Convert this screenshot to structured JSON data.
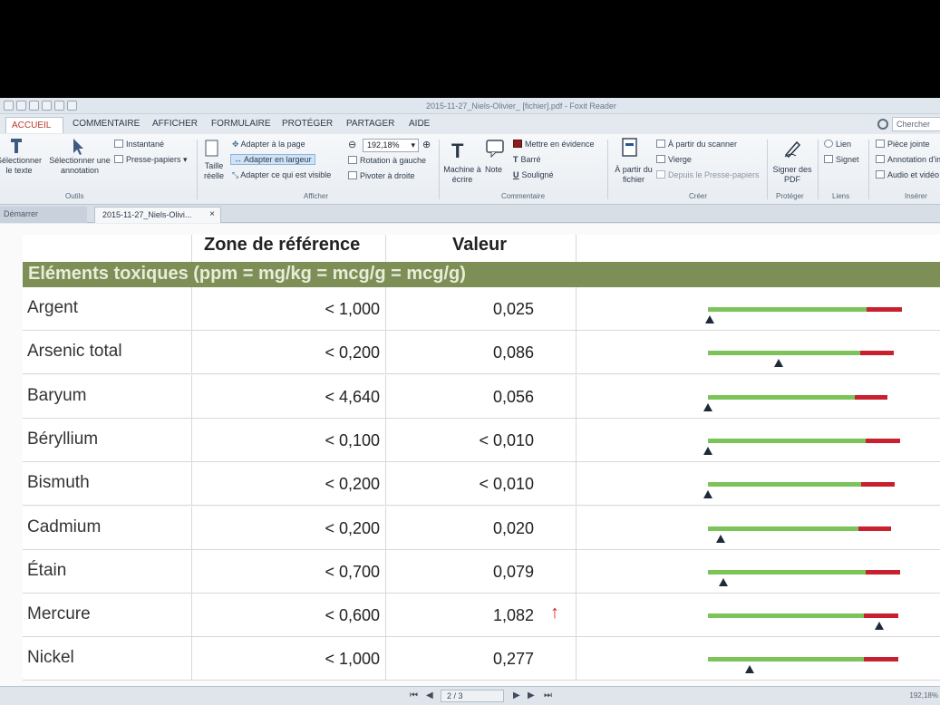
{
  "window": {
    "title": "2015-11-27_Niels-Olivier_  [fichier].pdf - Foxit Reader"
  },
  "menu": {
    "tabs": [
      "ACCUEIL",
      "COMMENTAIRE",
      "AFFICHER",
      "FORMULAIRE",
      "PROTÉGER",
      "PARTAGER",
      "AIDE"
    ],
    "search_label": "Chercher"
  },
  "ribbon": {
    "select_text": "Sélectionner le texte",
    "select_annotation": "Sélectionner une annotation",
    "snapshot": "Instantané",
    "clipboard": "Presse-papiers",
    "outils_group": "Outils",
    "taille_reelle": "Taille réelle",
    "fit_page": "Adapter à la page",
    "fit_width": "Adapter en largeur",
    "fit_visible": "Adapter ce qui est visible",
    "zoom": "192,18%",
    "rotate_left": "Rotation à gauche",
    "rotate_right": "Pivoter à droite",
    "afficher_group": "Afficher",
    "typewriter": "Machine à écrire",
    "note": "Note",
    "highlight": "Mettre en évidence",
    "strikeout": "Barré",
    "underline": "Souligné",
    "commentaire_group": "Commentaire",
    "from_file": "À partir du fichier",
    "from_scanner": "À partir du scanner",
    "blank": "Vierge",
    "from_clipboard": "Depuis le Presse-papiers",
    "creer_group": "Créer",
    "sign_pdf": "Signer des PDF",
    "proteger_group": "Protéger",
    "link": "Lien",
    "bookmark": "Signet",
    "liens_group": "Liens",
    "attachment": "Pièce jointe",
    "image_annotation": "Annotation d'image",
    "audio_video": "Audio et vidéo",
    "inserer_group": "Insérer"
  },
  "doc_tabs": {
    "start": "Démarrer",
    "file": "2015-11-27_Niels-Olivi...",
    "close": "×"
  },
  "table": {
    "col_ref": "Zone de référence",
    "col_val": "Valeur",
    "section": "Eléments toxiques (ppm = mg/kg = mcg/g = mcg/g)",
    "rows": [
      {
        "name": "Argent",
        "ref": "< 1,000",
        "value": "0,025",
        "flag": "",
        "level": 0.01
      },
      {
        "name": "Arsenic total",
        "ref": "< 0,200",
        "value": "0,086",
        "flag": "",
        "level": 0.38
      },
      {
        "name": "Baryum",
        "ref": "< 4,640",
        "value": "0,056",
        "flag": "",
        "level": 0.0
      },
      {
        "name": "Béryllium",
        "ref": "< 0,100",
        "value": "< 0,010",
        "flag": "",
        "level": 0.0
      },
      {
        "name": "Bismuth",
        "ref": "< 0,200",
        "value": "< 0,010",
        "flag": "",
        "level": 0.0
      },
      {
        "name": "Cadmium",
        "ref": "< 0,200",
        "value": "0,020",
        "flag": "",
        "level": 0.07
      },
      {
        "name": "Étain",
        "ref": "< 0,700",
        "value": "0,079",
        "flag": "",
        "level": 0.08
      },
      {
        "name": "Mercure",
        "ref": "< 0,600",
        "value": "1,082",
        "flag": "↑",
        "level": 0.9
      },
      {
        "name": "Nickel",
        "ref": "< 1,000",
        "value": "0,277",
        "flag": "",
        "level": 0.22
      }
    ]
  },
  "status": {
    "page": "2 / 3",
    "zoom": "192,18%"
  },
  "colors": {
    "section_band": "#7d8f57",
    "bar_green": "#7cc45a",
    "bar_red": "#c8202e",
    "flag": "#d8222d"
  }
}
